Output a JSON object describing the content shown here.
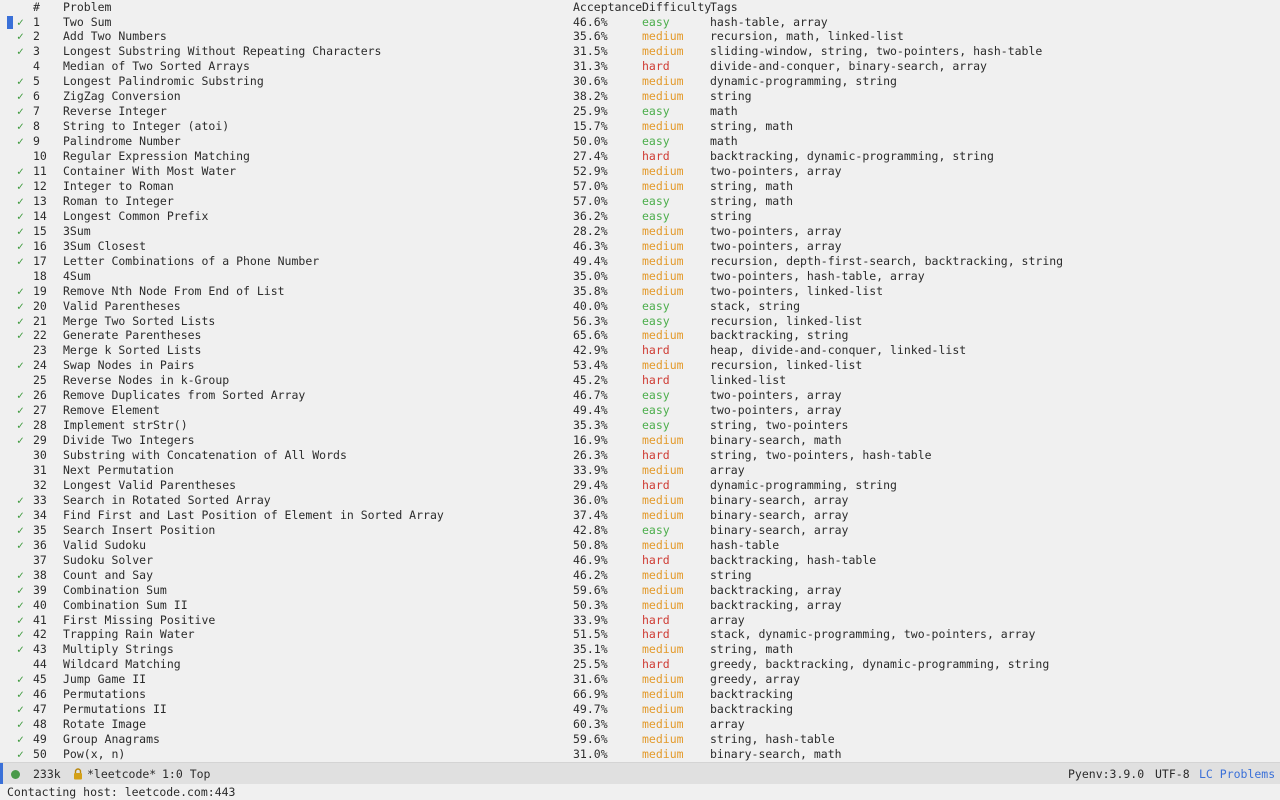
{
  "headers": {
    "num": "#",
    "title": "Problem",
    "acceptance": "Acceptance",
    "difficulty": "Difficulty",
    "tags": "Tags"
  },
  "check_glyph": "✓",
  "colors": {
    "easy": "#4cae4c",
    "medium": "#e39a2b",
    "hard": "#cf3b33",
    "check": "#3f9a3f",
    "accent": "#3a70d8"
  },
  "problems": [
    {
      "solved": true,
      "num": "1",
      "title": "Two Sum",
      "acceptance": "46.6%",
      "difficulty": "easy",
      "tags": "hash-table, array"
    },
    {
      "solved": true,
      "num": "2",
      "title": "Add Two Numbers",
      "acceptance": "35.6%",
      "difficulty": "medium",
      "tags": "recursion, math, linked-list"
    },
    {
      "solved": true,
      "num": "3",
      "title": "Longest Substring Without Repeating Characters",
      "acceptance": "31.5%",
      "difficulty": "medium",
      "tags": "sliding-window, string, two-pointers, hash-table"
    },
    {
      "solved": false,
      "num": "4",
      "title": "Median of Two Sorted Arrays",
      "acceptance": "31.3%",
      "difficulty": "hard",
      "tags": "divide-and-conquer, binary-search, array"
    },
    {
      "solved": true,
      "num": "5",
      "title": "Longest Palindromic Substring",
      "acceptance": "30.6%",
      "difficulty": "medium",
      "tags": "dynamic-programming, string"
    },
    {
      "solved": true,
      "num": "6",
      "title": "ZigZag Conversion",
      "acceptance": "38.2%",
      "difficulty": "medium",
      "tags": "string"
    },
    {
      "solved": true,
      "num": "7",
      "title": "Reverse Integer",
      "acceptance": "25.9%",
      "difficulty": "easy",
      "tags": "math"
    },
    {
      "solved": true,
      "num": "8",
      "title": "String to Integer (atoi)",
      "acceptance": "15.7%",
      "difficulty": "medium",
      "tags": "string, math"
    },
    {
      "solved": true,
      "num": "9",
      "title": "Palindrome Number",
      "acceptance": "50.0%",
      "difficulty": "easy",
      "tags": "math"
    },
    {
      "solved": false,
      "num": "10",
      "title": "Regular Expression Matching",
      "acceptance": "27.4%",
      "difficulty": "hard",
      "tags": "backtracking, dynamic-programming, string"
    },
    {
      "solved": true,
      "num": "11",
      "title": "Container With Most Water",
      "acceptance": "52.9%",
      "difficulty": "medium",
      "tags": "two-pointers, array"
    },
    {
      "solved": true,
      "num": "12",
      "title": "Integer to Roman",
      "acceptance": "57.0%",
      "difficulty": "medium",
      "tags": "string, math"
    },
    {
      "solved": true,
      "num": "13",
      "title": "Roman to Integer",
      "acceptance": "57.0%",
      "difficulty": "easy",
      "tags": "string, math"
    },
    {
      "solved": true,
      "num": "14",
      "title": "Longest Common Prefix",
      "acceptance": "36.2%",
      "difficulty": "easy",
      "tags": "string"
    },
    {
      "solved": true,
      "num": "15",
      "title": "3Sum",
      "acceptance": "28.2%",
      "difficulty": "medium",
      "tags": "two-pointers, array"
    },
    {
      "solved": true,
      "num": "16",
      "title": "3Sum Closest",
      "acceptance": "46.3%",
      "difficulty": "medium",
      "tags": "two-pointers, array"
    },
    {
      "solved": true,
      "num": "17",
      "title": "Letter Combinations of a Phone Number",
      "acceptance": "49.4%",
      "difficulty": "medium",
      "tags": "recursion, depth-first-search, backtracking, string"
    },
    {
      "solved": false,
      "num": "18",
      "title": "4Sum",
      "acceptance": "35.0%",
      "difficulty": "medium",
      "tags": "two-pointers, hash-table, array"
    },
    {
      "solved": true,
      "num": "19",
      "title": "Remove Nth Node From End of List",
      "acceptance": "35.8%",
      "difficulty": "medium",
      "tags": "two-pointers, linked-list"
    },
    {
      "solved": true,
      "num": "20",
      "title": "Valid Parentheses",
      "acceptance": "40.0%",
      "difficulty": "easy",
      "tags": "stack, string"
    },
    {
      "solved": true,
      "num": "21",
      "title": "Merge Two Sorted Lists",
      "acceptance": "56.3%",
      "difficulty": "easy",
      "tags": "recursion, linked-list"
    },
    {
      "solved": true,
      "num": "22",
      "title": "Generate Parentheses",
      "acceptance": "65.6%",
      "difficulty": "medium",
      "tags": "backtracking, string"
    },
    {
      "solved": false,
      "num": "23",
      "title": "Merge k Sorted Lists",
      "acceptance": "42.9%",
      "difficulty": "hard",
      "tags": "heap, divide-and-conquer, linked-list"
    },
    {
      "solved": true,
      "num": "24",
      "title": "Swap Nodes in Pairs",
      "acceptance": "53.4%",
      "difficulty": "medium",
      "tags": "recursion, linked-list"
    },
    {
      "solved": false,
      "num": "25",
      "title": "Reverse Nodes in k-Group",
      "acceptance": "45.2%",
      "difficulty": "hard",
      "tags": "linked-list"
    },
    {
      "solved": true,
      "num": "26",
      "title": "Remove Duplicates from Sorted Array",
      "acceptance": "46.7%",
      "difficulty": "easy",
      "tags": "two-pointers, array"
    },
    {
      "solved": true,
      "num": "27",
      "title": "Remove Element",
      "acceptance": "49.4%",
      "difficulty": "easy",
      "tags": "two-pointers, array"
    },
    {
      "solved": true,
      "num": "28",
      "title": "Implement strStr()",
      "acceptance": "35.3%",
      "difficulty": "easy",
      "tags": "string, two-pointers"
    },
    {
      "solved": true,
      "num": "29",
      "title": "Divide Two Integers",
      "acceptance": "16.9%",
      "difficulty": "medium",
      "tags": "binary-search, math"
    },
    {
      "solved": false,
      "num": "30",
      "title": "Substring with Concatenation of All Words",
      "acceptance": "26.3%",
      "difficulty": "hard",
      "tags": "string, two-pointers, hash-table"
    },
    {
      "solved": false,
      "num": "31",
      "title": "Next Permutation",
      "acceptance": "33.9%",
      "difficulty": "medium",
      "tags": "array"
    },
    {
      "solved": false,
      "num": "32",
      "title": "Longest Valid Parentheses",
      "acceptance": "29.4%",
      "difficulty": "hard",
      "tags": "dynamic-programming, string"
    },
    {
      "solved": true,
      "num": "33",
      "title": "Search in Rotated Sorted Array",
      "acceptance": "36.0%",
      "difficulty": "medium",
      "tags": "binary-search, array"
    },
    {
      "solved": true,
      "num": "34",
      "title": "Find First and Last Position of Element in Sorted Array",
      "acceptance": "37.4%",
      "difficulty": "medium",
      "tags": "binary-search, array"
    },
    {
      "solved": true,
      "num": "35",
      "title": "Search Insert Position",
      "acceptance": "42.8%",
      "difficulty": "easy",
      "tags": "binary-search, array"
    },
    {
      "solved": true,
      "num": "36",
      "title": "Valid Sudoku",
      "acceptance": "50.8%",
      "difficulty": "medium",
      "tags": "hash-table"
    },
    {
      "solved": false,
      "num": "37",
      "title": "Sudoku Solver",
      "acceptance": "46.9%",
      "difficulty": "hard",
      "tags": "backtracking, hash-table"
    },
    {
      "solved": true,
      "num": "38",
      "title": "Count and Say",
      "acceptance": "46.2%",
      "difficulty": "medium",
      "tags": "string"
    },
    {
      "solved": true,
      "num": "39",
      "title": "Combination Sum",
      "acceptance": "59.6%",
      "difficulty": "medium",
      "tags": "backtracking, array"
    },
    {
      "solved": true,
      "num": "40",
      "title": "Combination Sum II",
      "acceptance": "50.3%",
      "difficulty": "medium",
      "tags": "backtracking, array"
    },
    {
      "solved": true,
      "num": "41",
      "title": "First Missing Positive",
      "acceptance": "33.9%",
      "difficulty": "hard",
      "tags": "array"
    },
    {
      "solved": true,
      "num": "42",
      "title": "Trapping Rain Water",
      "acceptance": "51.5%",
      "difficulty": "hard",
      "tags": "stack, dynamic-programming, two-pointers, array"
    },
    {
      "solved": true,
      "num": "43",
      "title": "Multiply Strings",
      "acceptance": "35.1%",
      "difficulty": "medium",
      "tags": "string, math"
    },
    {
      "solved": false,
      "num": "44",
      "title": "Wildcard Matching",
      "acceptance": "25.5%",
      "difficulty": "hard",
      "tags": "greedy, backtracking, dynamic-programming, string"
    },
    {
      "solved": true,
      "num": "45",
      "title": "Jump Game II",
      "acceptance": "31.6%",
      "difficulty": "medium",
      "tags": "greedy, array"
    },
    {
      "solved": true,
      "num": "46",
      "title": "Permutations",
      "acceptance": "66.9%",
      "difficulty": "medium",
      "tags": "backtracking"
    },
    {
      "solved": true,
      "num": "47",
      "title": "Permutations II",
      "acceptance": "49.7%",
      "difficulty": "medium",
      "tags": "backtracking"
    },
    {
      "solved": true,
      "num": "48",
      "title": "Rotate Image",
      "acceptance": "60.3%",
      "difficulty": "medium",
      "tags": "array"
    },
    {
      "solved": true,
      "num": "49",
      "title": "Group Anagrams",
      "acceptance": "59.6%",
      "difficulty": "medium",
      "tags": "string, hash-table"
    },
    {
      "solved": true,
      "num": "50",
      "title": "Pow(x, n)",
      "acceptance": "31.0%",
      "difficulty": "medium",
      "tags": "binary-search, math"
    }
  ],
  "modeline": {
    "buffer_size": "233k",
    "buffer_name": "*leetcode*",
    "position": "1:0 Top",
    "env": "Pyenv:3.9.0",
    "encoding": "UTF-8",
    "mode": "LC Problems"
  },
  "echo_area": "Contacting host: leetcode.com:443"
}
